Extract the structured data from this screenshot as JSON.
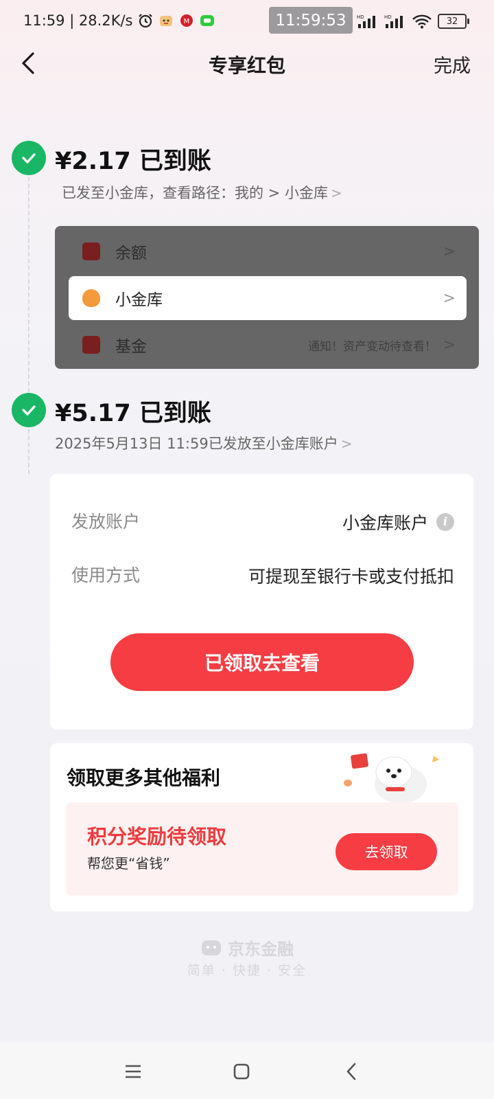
{
  "status_bar": {
    "left_text": "11:59 | 28.2K/s",
    "center_time": "11:59:53",
    "battery": "32"
  },
  "header": {
    "title": "专享红包",
    "done_label": "完成"
  },
  "entry1": {
    "amount": "¥2.17 已到账",
    "subtitle": "已发至小金库，查看路径：我的 > 小金库"
  },
  "overlay_menu": {
    "items": [
      {
        "label": "余额",
        "note": ""
      },
      {
        "label": "小金库",
        "note": ""
      },
      {
        "label": "基金",
        "note": "通知！资产变动待查看！"
      }
    ]
  },
  "entry2": {
    "amount": "¥5.17 已到账",
    "subtitle": "2025年5月13日 11:59已发放至小金库账户"
  },
  "details": {
    "account_label": "发放账户",
    "account_value": "小金库账户",
    "usage_label": "使用方式",
    "usage_value": "可提现至银行卡或支付抵扣",
    "button_label": "已领取去查看"
  },
  "benefits": {
    "title": "领取更多其他福利",
    "heading": "积分奖励待领取",
    "subtext": "帮您更“省钱”",
    "button_label": "去领取"
  },
  "footer": {
    "brand": "京东金融",
    "slogan": "简单 · 快捷 · 安全"
  },
  "colors": {
    "accent_red": "#f63d43",
    "success_green": "#19b765"
  }
}
